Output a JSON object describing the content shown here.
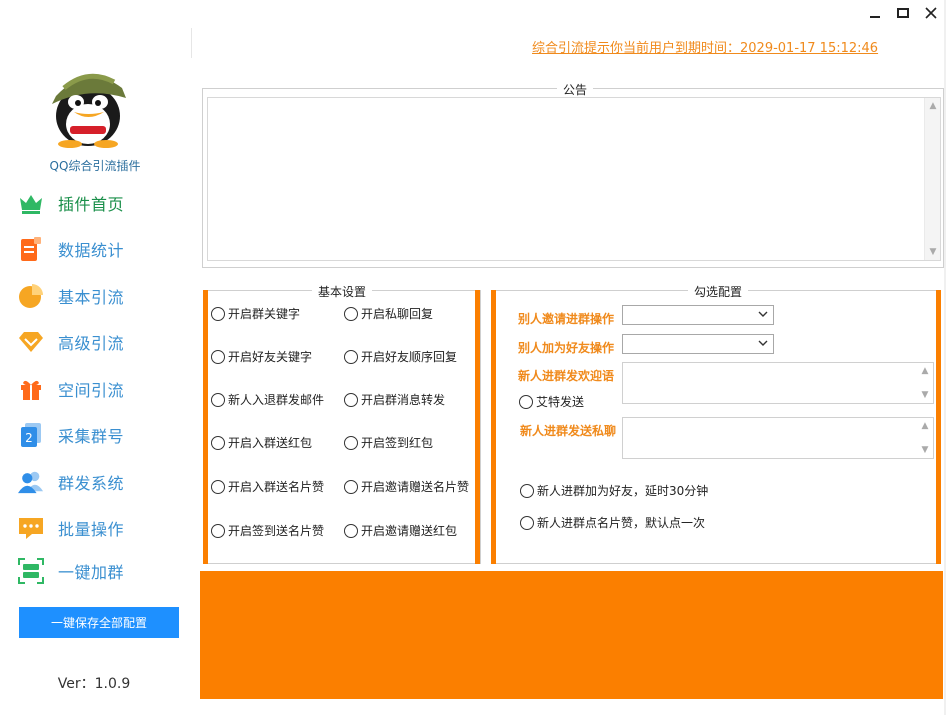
{
  "app": {
    "name": "QQ综合引流插件",
    "version": "Ver：1.0.9",
    "save_label": "一键保存全部配置",
    "expiry_text": "综合引流提示你当前用户到期时间：2029-01-17 15:12:46"
  },
  "nav": [
    {
      "label": "插件首页",
      "icon": "crown-icon",
      "color": "#2fb864"
    },
    {
      "label": "数据统计",
      "icon": "report-icon",
      "color": "#ff6a1a"
    },
    {
      "label": "基本引流",
      "icon": "pie-icon",
      "color": "#f6a623"
    },
    {
      "label": "高级引流",
      "icon": "diamond-icon",
      "color": "#f6a623"
    },
    {
      "label": "空间引流",
      "icon": "gift-icon",
      "color": "#ff6a1a"
    },
    {
      "label": "采集群号",
      "icon": "number-card-icon",
      "color": "#2f8ee8"
    },
    {
      "label": "群发系统",
      "icon": "users-icon",
      "color": "#2f8ee8"
    },
    {
      "label": "批量操作",
      "icon": "chat-bubble-icon",
      "color": "#f6a623"
    },
    {
      "label": "一键加群",
      "icon": "scan-icon",
      "color": "#2fb864"
    }
  ],
  "notice": {
    "title": "公告",
    "content": ""
  },
  "basic": {
    "title": "基本设置",
    "options": [
      "开启群关键字",
      "开启私聊回复",
      "开启好友关键字",
      "开启好友顺序回复",
      "新人入退群发邮件",
      "开启群消息转发",
      "开启入群送红包",
      "开启签到红包",
      "开启入群送名片赞",
      "开启邀请赠送名片赞",
      "开启签到送名片赞",
      "开启邀请赠送红包"
    ]
  },
  "config": {
    "title": "勾选配置",
    "invite_label": "别人邀请进群操作",
    "invite_value": "",
    "friend_label": "别人加为好友操作",
    "friend_value": "",
    "welcome_label": "新人进群发欢迎语",
    "welcome_value": "",
    "at_send_label": "艾特发送",
    "private_label": "新人进群发送私聊",
    "private_value": "",
    "add_friend_label": "新人进群加为好友，延时30分钟",
    "like_label": "新人进群点名片赞，默认点一次"
  }
}
